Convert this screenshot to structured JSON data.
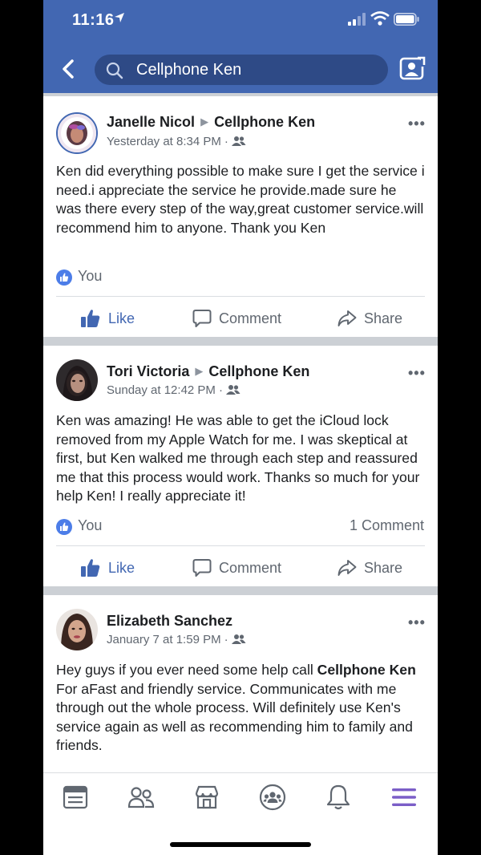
{
  "status_bar": {
    "time": "11:16"
  },
  "search": {
    "query": "Cellphone Ken"
  },
  "posts": [
    {
      "author": "Janelle Nicol",
      "target": "Cellphone Ken",
      "time": "Yesterday at 8:34 PM",
      "body": "Ken did everything possible to make sure I get the service i need.i appreciate the service he provide.made sure he was there every step of the way,great customer service.will recommend him to anyone. Thank you Ken",
      "reactions": "You",
      "comments": ""
    },
    {
      "author": "Tori Victoria",
      "target": "Cellphone Ken",
      "time": "Sunday at 12:42 PM",
      "body": "Ken was amazing! He was able to get the iCloud lock removed from my Apple Watch for me. I was skeptical at first, but Ken walked me through each step and reassured me that this process would work. Thanks so much for your help Ken! I really appreciate it!",
      "reactions": "You",
      "comments": "1 Comment"
    },
    {
      "author": "Elizabeth Sanchez",
      "time": "January 7 at 1:59 PM",
      "body_pre": "Hey guys if you ever need some help call ",
      "body_bold": "Cellphone Ken",
      "body_post": " For aFast and friendly service.  Communicates with me through out the whole process. Will definitely use Ken's service again as well as recommending him to family and friends."
    }
  ],
  "actions": {
    "like": "Like",
    "comment": "Comment",
    "share": "Share"
  },
  "colors": {
    "brand": "#4267b2",
    "search_bg": "#2e4a86",
    "like_badge": "#4c7de8",
    "menu_active": "#7b5ec7"
  }
}
